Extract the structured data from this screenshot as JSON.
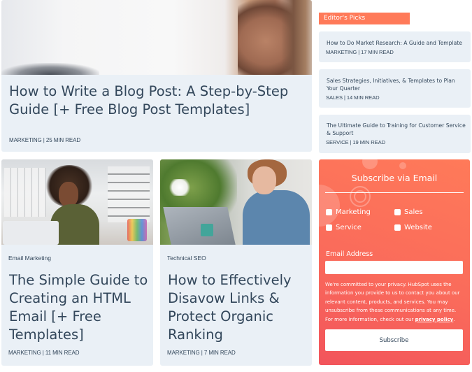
{
  "hero": {
    "title": "How to Write a Blog Post: A Step-by-Step Guide [+ Free Blog Post Templates]",
    "meta": "MARKETING | 25 MIN READ",
    "image_alt": "woman looking at screen"
  },
  "editors_picks": {
    "header": "Editor's Picks",
    "items": [
      {
        "title": "How to Do Market Research: A Guide and Template",
        "meta": "MARKETING | 17 MIN READ"
      },
      {
        "title": "Sales Strategies, Initiatives, & Templates to Plan Your Quarter",
        "meta": "SALES | 14 MIN READ"
      },
      {
        "title": "The Ultimate Guide to Training for Customer Service & Support",
        "meta": "SERVICE | 19 MIN READ"
      }
    ]
  },
  "posts": [
    {
      "category": "Email Marketing",
      "title": "The Simple Guide to Creating an HTML Email [+ Free Templates]",
      "meta": "MARKETING | 11 MIN READ"
    },
    {
      "category": "Technical SEO",
      "title": "How to Effectively Disavow Links & Protect Organic Ranking",
      "meta": "MARKETING | 7 MIN READ"
    }
  ],
  "subscribe": {
    "title": "Subscribe via Email",
    "options": [
      {
        "label": "Marketing",
        "checked": false
      },
      {
        "label": "Sales",
        "checked": false
      },
      {
        "label": "Service",
        "checked": false
      },
      {
        "label": "Website",
        "checked": false
      }
    ],
    "email_label": "Email Address",
    "email_value": "",
    "privacy_text": "We're committed to your privacy. HubSpot uses the information you provide to us to contact you about our relevant content, products, and services. You may unsubscribe from these communications at any time. For more information, check out our ",
    "privacy_link": "privacy policy",
    "privacy_end": ".",
    "button_label": "Subscribe"
  },
  "colors": {
    "accent": "#ff7a59",
    "card_bg": "#eaf0f6",
    "text": "#33475b",
    "subscribe_gradient_end": "#f2545b"
  }
}
